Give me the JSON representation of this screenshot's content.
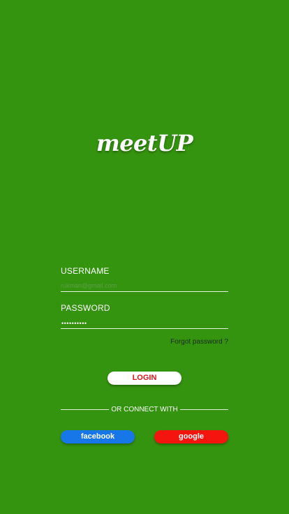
{
  "app": {
    "logo_text": "meetUP"
  },
  "colors": {
    "background": "#34940f",
    "login_text": "#e0141d",
    "facebook": "#1877e8",
    "google": "#f5150f"
  },
  "form": {
    "username_label": "USERNAME",
    "username_placeholder": "rukman@gmail.com",
    "password_label": "PASSWORD",
    "password_value": "••••••••••",
    "forgot_label": "Forgot password ?"
  },
  "actions": {
    "login_label": "LOGIN",
    "divider_text": "OR CONNECT WITH",
    "facebook_label": "facebook",
    "google_label": "google"
  }
}
